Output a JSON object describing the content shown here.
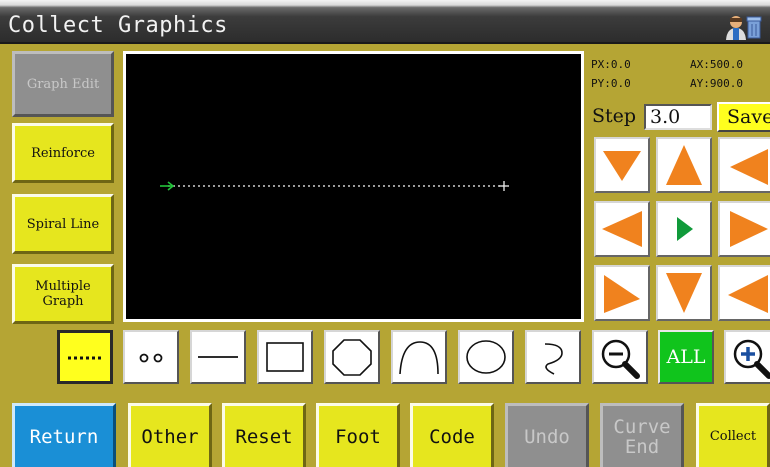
{
  "window": {
    "title": "Collect Graphics"
  },
  "sidebar": {
    "graph_edit": "Graph Edit",
    "reinforce": "Reinforce",
    "spiral_line": "Spiral Line",
    "multiple_graph": "Multiple Graph"
  },
  "coords": {
    "px": "PX:0.0",
    "py": "PY:0.0",
    "ax": "AX:500.0",
    "ay": "AY:900.0"
  },
  "step": {
    "label": "Step",
    "value": "3.0"
  },
  "save_label": "Save",
  "tools": {
    "all_label": "ALL"
  },
  "bottom": {
    "return": "Return",
    "other": "Other",
    "reset": "Reset",
    "foot": "Foot",
    "code": "Code",
    "undo": "Undo",
    "curve_end_line1": "Curve",
    "curve_end_line2": "End",
    "collect": "Collect"
  },
  "colors": {
    "panel": "#b5a534",
    "button_active": "#e6e61e",
    "button_disabled": "#8f8f8f",
    "return_button": "#1a8fd6",
    "all_button": "#10c41c",
    "arrow": "#f0821e",
    "center_arrow": "#109a3a"
  }
}
